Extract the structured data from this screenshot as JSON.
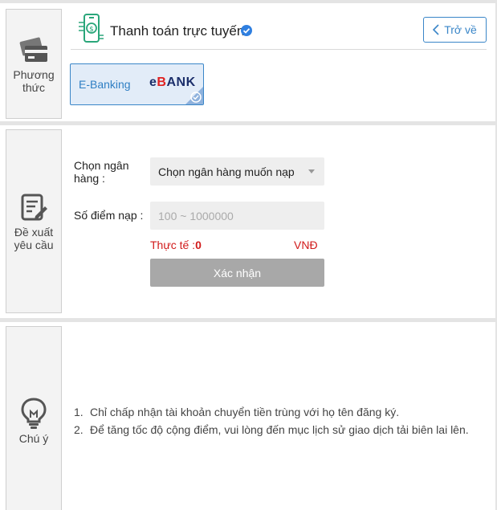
{
  "method_section": {
    "side_label": "Phương thức",
    "header_title": "Thanh toán trực tuyến",
    "back_label": "Trở về",
    "ebank_card": {
      "label": "E-Banking",
      "logo_e": "e",
      "logo_b": "B",
      "logo_rest": "ANK"
    },
    "icons": [
      "card-icon",
      "payment-phone-icon",
      "verified-check-icon",
      "chevron-left-icon",
      "selected-check-icon"
    ]
  },
  "request_section": {
    "side_label": "Đề xuất yêu cầu",
    "bank_label": "Chọn ngân hàng :",
    "bank_select_value": "Chọn ngân hàng muốn nạp",
    "points_label": "Số điểm nạp :",
    "points_placeholder": "100 ~ 1000000",
    "actual_label": "Thực tế :",
    "actual_value": "0",
    "currency": "VNĐ",
    "confirm_label": "Xác nhận",
    "icons": [
      "edit-form-icon",
      "dropdown-caret-icon"
    ]
  },
  "notice_section": {
    "side_label": "Chú ý",
    "notes": [
      {
        "num": "1.",
        "text": "Chỉ chấp nhận tài khoản chuyển tiền trùng với họ tên đăng ký."
      },
      {
        "num": "2.",
        "text": "Để tăng tốc độ cộng điểm, vui lòng đến mục lịch sử giao dịch tải biên lai lên."
      }
    ],
    "icons": [
      "lightbulb-icon"
    ]
  },
  "colors": {
    "accent": "#3a86c8",
    "alert": "#d11a1a",
    "button_disabled": "#a8a8a8",
    "card_bg": "#e2ecf8"
  }
}
